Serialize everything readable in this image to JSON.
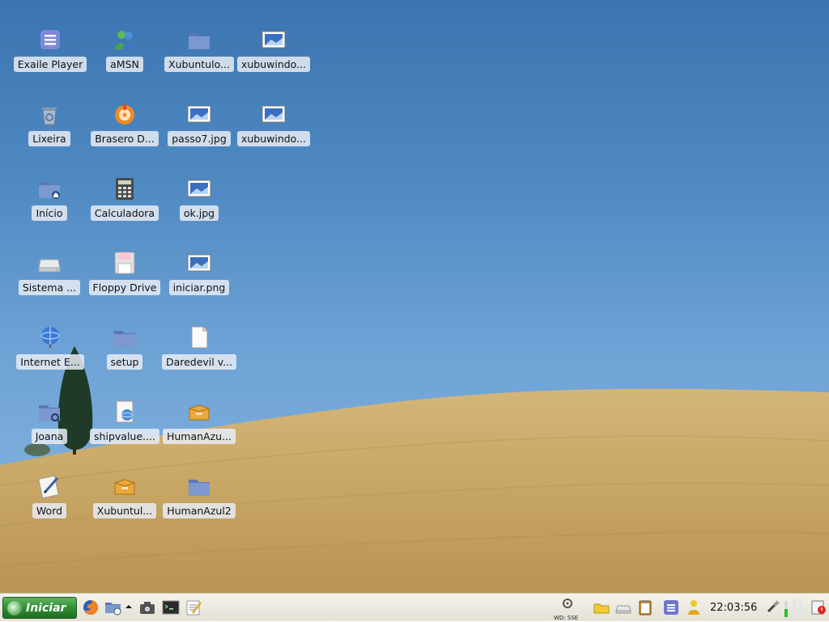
{
  "desktop": {
    "icons": [
      {
        "label": "Exaile Player",
        "icon": "exaile-player-icon"
      },
      {
        "label": "aMSN",
        "icon": "amsn-messenger-icon"
      },
      {
        "label": "Xubuntulo...",
        "icon": "folder-icon"
      },
      {
        "label": "xubuwindo...",
        "icon": "image-file-icon"
      },
      {
        "label": "Lixeira",
        "icon": "trash-icon"
      },
      {
        "label": "Brasero D...",
        "icon": "brasero-disc-icon"
      },
      {
        "label": "passo7.jpg",
        "icon": "image-file-icon"
      },
      {
        "label": "xubuwindo...",
        "icon": "image-file-icon"
      },
      {
        "label": "Início",
        "icon": "home-folder-icon"
      },
      {
        "label": "Calculadora",
        "icon": "calculator-icon"
      },
      {
        "label": "ok.jpg",
        "icon": "image-file-icon"
      },
      {
        "label": "Sistema ...",
        "icon": "hard-drive-icon"
      },
      {
        "label": "Floppy Drive",
        "icon": "floppy-drive-icon"
      },
      {
        "label": "iniciar.png",
        "icon": "image-file-icon"
      },
      {
        "label": "Internet E...",
        "icon": "internet-globe-icon"
      },
      {
        "label": "setup",
        "icon": "folder-icon"
      },
      {
        "label": "Daredevil v...",
        "icon": "document-file-icon"
      },
      {
        "label": "Joana",
        "icon": "search-folder-icon"
      },
      {
        "label": "shipvalue....",
        "icon": "web-document-icon"
      },
      {
        "label": "HumanAzu...",
        "icon": "package-box-icon"
      },
      {
        "label": "Word",
        "icon": "word-processor-icon"
      },
      {
        "label": "Xubuntul...",
        "icon": "package-box-icon"
      },
      {
        "label": "HumanAzul2",
        "icon": "folder-icon"
      }
    ]
  },
  "taskbar": {
    "start_label": "Iniciar",
    "launchers": [
      "firefox-icon",
      "file-manager-icon",
      "camera-icon",
      "terminal-icon",
      "text-editor-icon"
    ],
    "wifi_label": "WD: SSE",
    "clock": "22:03:56"
  },
  "colors": {
    "sky": "#4f89c2",
    "field": "#c9a868",
    "start_green": "#2f8a34",
    "taskbar": "#ebe8df"
  }
}
